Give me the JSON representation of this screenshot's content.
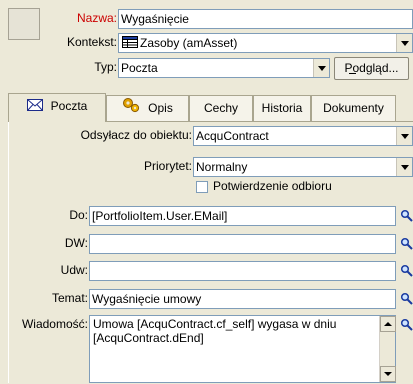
{
  "header": {
    "name_label": "Nazwa:",
    "name_value": "Wygaśnięcie",
    "context_label": "Kontekst:",
    "context_value": "Zasoby (amAsset)",
    "type_label": "Typ:",
    "type_value": "Poczta",
    "preview_button": "Podgląd..."
  },
  "tabs": [
    {
      "label": "Poczta",
      "icon": "envelope-icon"
    },
    {
      "label": "Opis",
      "icon": "gears-icon"
    },
    {
      "label": "Cechy"
    },
    {
      "label": "Historia"
    },
    {
      "label": "Dokumenty"
    }
  ],
  "mail": {
    "ref_label": "Odsyłacz do obiektu:",
    "ref_value": "AcquContract",
    "priority_label": "Priorytet:",
    "priority_value": "Normalny",
    "receipt_label": "Potwierdzenie odbioru",
    "to_label": "Do:",
    "to_value": "[PortfolioItem.User.EMail]",
    "cc_label": "DW:",
    "cc_value": "",
    "bcc_label": "Udw:",
    "bcc_value": "",
    "subject_label": "Temat:",
    "subject_value": "Wygaśnięcie umowy",
    "message_label": "Wiadomość:",
    "message_value": "Umowa [AcquContract.cf_self] wygasa w dniu [AcquContract.dEnd]"
  },
  "colors": {
    "name_label": "#cc0000",
    "field_border": "#7f9db9"
  }
}
